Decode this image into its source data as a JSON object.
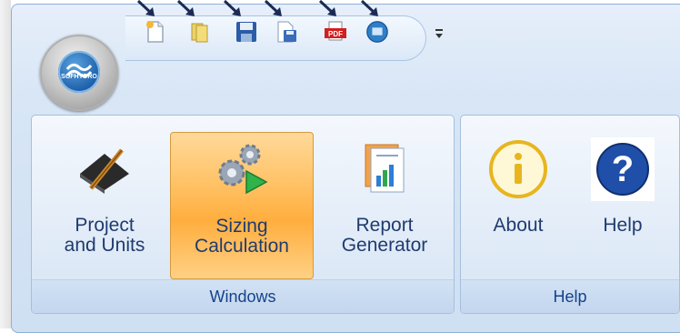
{
  "quick_access": {
    "buttons": [
      {
        "name": "new-file-icon"
      },
      {
        "name": "open-folder-icon"
      },
      {
        "name": "save-icon"
      },
      {
        "name": "save-as-icon"
      },
      {
        "name": "pdf-export-icon"
      },
      {
        "name": "monitor-icon"
      }
    ],
    "more_icon": "chevron-down-icon"
  },
  "app_orb": {
    "logo_text": "SOFHYDRO"
  },
  "ribbon": {
    "windows_group": {
      "label": "Windows",
      "buttons": [
        {
          "label": "Project\nand Units",
          "icon": "ruler-pencil-icon",
          "active": false
        },
        {
          "label": "Sizing\nCalculation",
          "icon": "gears-play-icon",
          "active": true
        },
        {
          "label": "Report\nGenerator",
          "icon": "report-chart-icon",
          "active": false
        }
      ]
    },
    "help_group": {
      "label": "Help",
      "buttons": [
        {
          "label": "About",
          "icon": "info-icon"
        },
        {
          "label": "Help",
          "icon": "question-icon"
        }
      ]
    }
  },
  "colors": {
    "active_button": "#ffc266",
    "group_label_text": "#15428b",
    "arrow": "#1c2a55"
  }
}
